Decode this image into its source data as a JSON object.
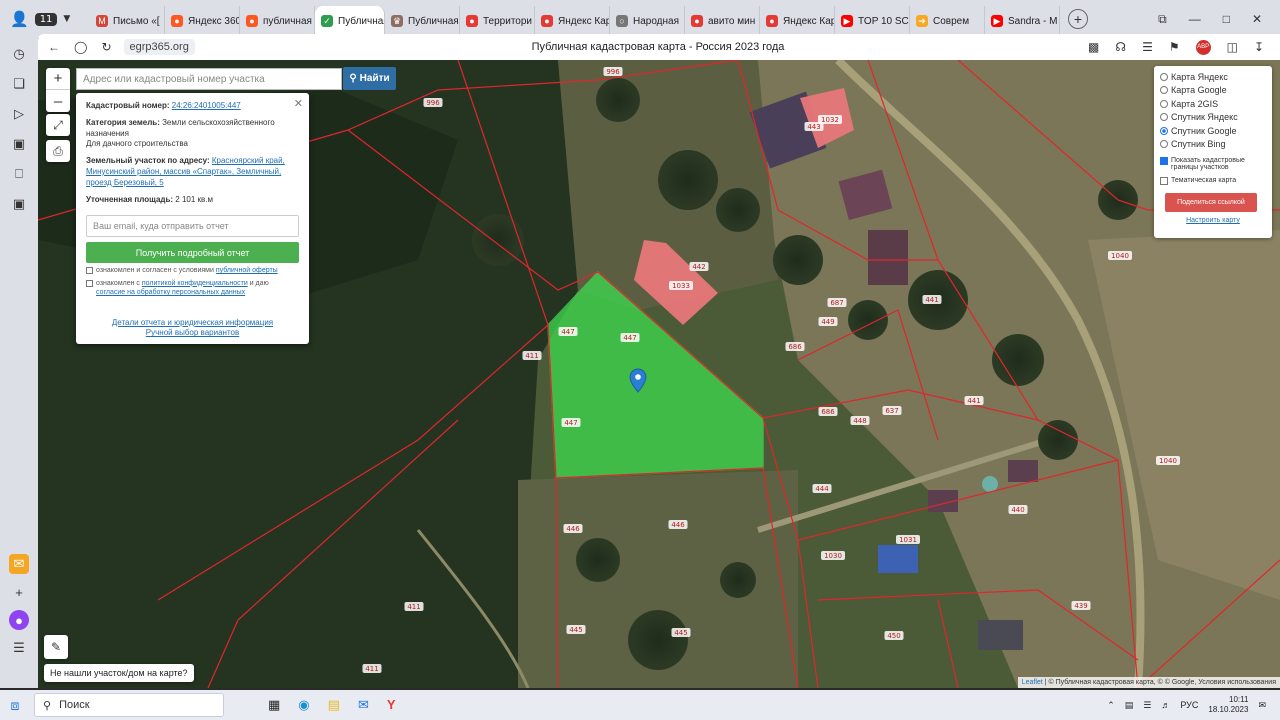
{
  "browser": {
    "tab_count": "11",
    "tabs": [
      {
        "label": "Письмо «[",
        "color": "#d44638",
        "glyph": "M"
      },
      {
        "label": "Яндекс 360",
        "color": "#ff5722",
        "glyph": "●"
      },
      {
        "label": "публичная",
        "color": "#ff5722",
        "glyph": "●"
      },
      {
        "label": "Публичная",
        "color": "#2e9e4e",
        "glyph": "✓",
        "active": true
      },
      {
        "label": "Публичная",
        "color": "#8d6e63",
        "glyph": "♛"
      },
      {
        "label": "Территори",
        "color": "#e53935",
        "glyph": "●"
      },
      {
        "label": "Яндекс Кар",
        "color": "#e53935",
        "glyph": "●"
      },
      {
        "label": "Народная",
        "color": "#777777",
        "glyph": "○"
      },
      {
        "label": "авито мин",
        "color": "#e53935",
        "glyph": "●"
      },
      {
        "label": "Яндекс Кар",
        "color": "#e53935",
        "glyph": "●"
      },
      {
        "label": "TOP 10 SCI",
        "color": "#ff0000",
        "glyph": "▶"
      },
      {
        "label": "Соврем",
        "color": "#f9a825",
        "glyph": "➔"
      },
      {
        "label": "Sandra - M",
        "color": "#ff0000",
        "glyph": "▶"
      }
    ],
    "url": "egrp365.org",
    "page_title": "Публичная кадастровая карта - Россия 2023 года"
  },
  "map": {
    "search_placeholder": "Адрес или кадастровый номер участка",
    "search_button": "Найти",
    "popup": {
      "cadastral_label": "Кадастровый номер:",
      "cadastral_value": "24:26:2401005:447",
      "category_label": "Категория земель:",
      "category_value": "Земли сельскохозяйственного назначения",
      "purpose": "Для дачного строительства",
      "address_label": "Земельный участок по адресу:",
      "address_value": "Красноярский край, Минусинский район, массив «Спартак», Земличный, проезд Березовый, 5",
      "area_label": "Уточненная площадь:",
      "area_value": "2 101 кв.м",
      "email_placeholder": "Ваш email, куда отправить отчет",
      "report_button": "Получить подробный отчет",
      "consent1_text": "ознакомлен и согласен с условиями",
      "consent1_link": "публичной оферты",
      "consent2_text": "ознакомлен с",
      "consent2_link": "политикой конфиденциальности",
      "consent2_mid": "и даю",
      "consent2_link2": "согласие на обработку персональных данных",
      "details_link": "Детали отчета и юридическая информация",
      "manual_link": "Ручной выбор вариантов"
    },
    "layers": {
      "options": [
        {
          "label": "Карта Яндекс",
          "selected": false
        },
        {
          "label": "Карта Google",
          "selected": false
        },
        {
          "label": "Карта 2GIS",
          "selected": false
        },
        {
          "label": "Спутник Яндекс",
          "selected": false
        },
        {
          "label": "Спутник Google",
          "selected": true
        },
        {
          "label": "Спутник Bing",
          "selected": false
        }
      ],
      "show_borders": "Показать кадастровые границы участков",
      "thematic": "Тематическая карта",
      "share_button": "Поделиться ссылкой",
      "setup_link": "Настроить карту"
    },
    "not_found": "Не нашли участок/дом на карте?",
    "attribution_leaflet": "Leaflet",
    "attribution_rest": "| © Публичная кадастровая карта, © © Google, Условия использования",
    "parcel_labels": [
      "447",
      "447",
      "447",
      "442",
      "1033",
      "1032",
      "443",
      "411",
      "411",
      "411",
      "687",
      "449",
      "686",
      "686",
      "448",
      "637",
      "441",
      "441",
      "444",
      "446",
      "446",
      "445",
      "445",
      "1030",
      "1031",
      "440",
      "439",
      "450",
      "1040",
      "1040",
      "996",
      "996"
    ],
    "colors": {
      "selected_parcel": "#3ddc4e",
      "building": "#e8777a",
      "boundary": "#e0262c",
      "marker": "#2a7fd4"
    }
  },
  "taskbar": {
    "search": "Поиск",
    "lang": "РУС",
    "time": "10:11",
    "date": "18.10.2023"
  }
}
